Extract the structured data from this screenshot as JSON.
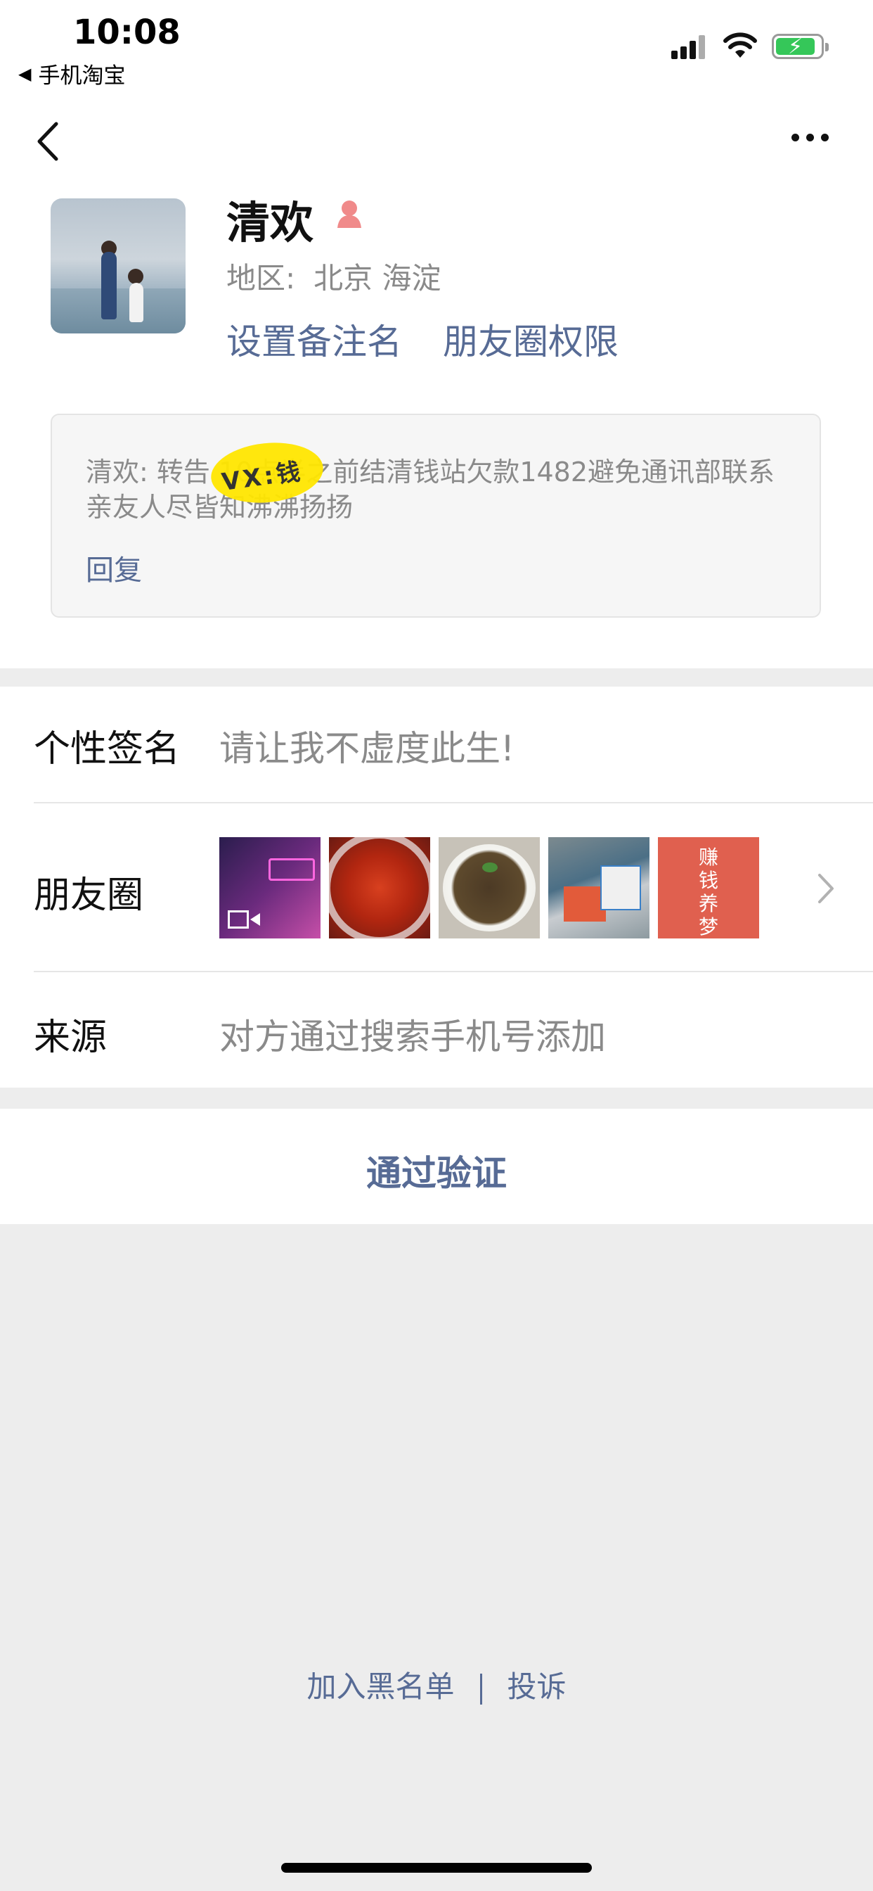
{
  "status_bar": {
    "time": "10:08",
    "back_app": "手机淘宝",
    "accent_battery": "#35c759"
  },
  "nav": {
    "back_icon": "chevron-left-icon",
    "more_icon": "more-icon"
  },
  "profile": {
    "name": "清欢",
    "gender_icon": "female-icon",
    "region_label": "地区:",
    "region_value": "北京 海淀",
    "set_remark": "设置备注名",
    "moments_permission": "朋友圈权限"
  },
  "message": {
    "text": "清欢: 转告 10点半之前结清钱站欠款1482避免通讯部联系亲友人尽皆知沸沸扬扬",
    "scribble": "VX:钱",
    "reply": "回复"
  },
  "rows": {
    "signature_label": "个性签名",
    "signature_value": "请让我不虚度此生!",
    "moments_label": "朋友圈",
    "moments_thumb5_text": "赚钱养梦",
    "source_label": "来源",
    "source_value": "对方通过搜索手机号添加"
  },
  "actions": {
    "verify": "通过验证"
  },
  "footer": {
    "blacklist": "加入黑名单",
    "complain": "投诉"
  },
  "colors": {
    "link": "#576b95",
    "background": "#ededed",
    "gray_text": "#8a8a8a"
  }
}
